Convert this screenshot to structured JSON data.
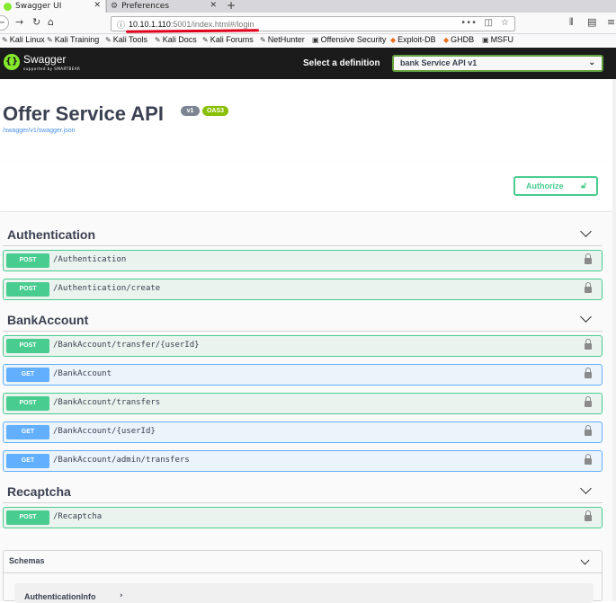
{
  "browser": {
    "tabs": [
      {
        "label": "Swagger UI",
        "active": true
      },
      {
        "label": "Preferences",
        "active": false
      }
    ],
    "new_tab": "+",
    "url_host": "10.10.1.110",
    "url_path": ":5001/index.html#/login",
    "bookmarks": [
      "Kali Linux",
      "Kali Training",
      "Kali Tools",
      "Kali Docs",
      "Kali Forums",
      "NetHunter",
      "Offensive Security",
      "Exploit-DB",
      "GHDB",
      "MSFU"
    ]
  },
  "topbar": {
    "logo": "Swagger",
    "logo_sub": "supported by SMARTBEAR",
    "definition_label": "Select a definition",
    "definition_value": "bank Service API v1"
  },
  "info": {
    "title": "Offer Service API",
    "version": "v1",
    "oas": "OAS3",
    "link": "/swagger/v1/swagger.json"
  },
  "authorize_label": "Authorize",
  "tags": [
    {
      "name": "Authentication",
      "operations": [
        {
          "method": "POST",
          "path": "/Authentication"
        },
        {
          "method": "POST",
          "path": "/Authentication/create"
        }
      ]
    },
    {
      "name": "BankAccount",
      "operations": [
        {
          "method": "POST",
          "path": "/BankAccount/transfer/{userId}"
        },
        {
          "method": "GET",
          "path": "/BankAccount"
        },
        {
          "method": "POST",
          "path": "/BankAccount/transfers"
        },
        {
          "method": "GET",
          "path": "/BankAccount/{userId}"
        },
        {
          "method": "GET",
          "path": "/BankAccount/admin/transfers"
        }
      ]
    },
    {
      "name": "Recaptcha",
      "operations": [
        {
          "method": "POST",
          "path": "/Recaptcha"
        }
      ]
    }
  ],
  "schemas": {
    "title": "Schemas",
    "models": [
      "AuthenticationInfo"
    ]
  },
  "colors": {
    "post": "#49cc90",
    "get": "#61affe",
    "topbar": "#1b1b1b",
    "brand": "#85ea2d"
  }
}
